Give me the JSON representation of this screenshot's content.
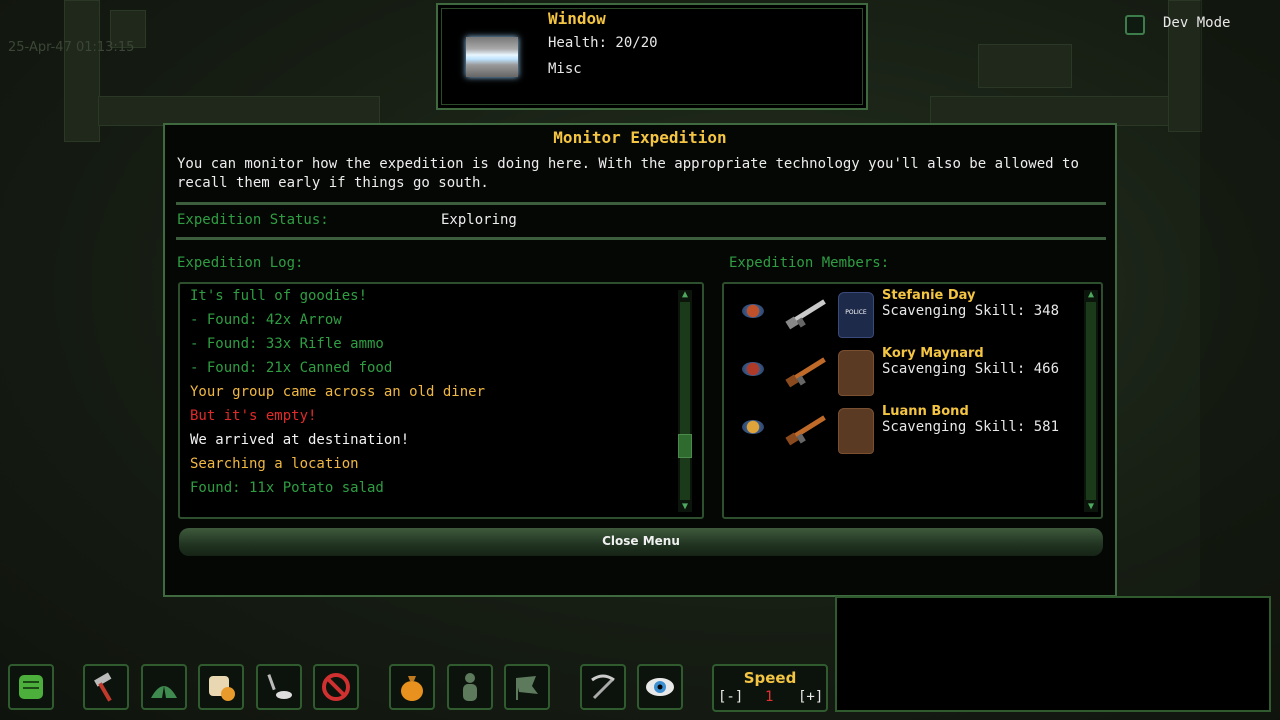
{
  "date_stamp": "25-Apr-47 01:13:15",
  "info_window": {
    "title": "Window",
    "health": "Health: 20/20",
    "category": "Misc"
  },
  "dev_mode": {
    "label": "Dev Mode",
    "checked": false
  },
  "dialog": {
    "title": "Monitor Expedition",
    "description": "You can monitor how the expedition is doing here. With the appropriate technology you'll also be allowed to recall them early if things go south.",
    "status_label": "Expedition Status:",
    "status_value": "Exploring",
    "log_label": "Expedition Log:",
    "members_label": "Expedition Members:",
    "log": [
      {
        "text": "It's full of goodies!",
        "color": "#2f9e43"
      },
      {
        "text": "- Found: 42x Arrow",
        "color": "#2f9e43"
      },
      {
        "text": "- Found: 33x Rifle ammo",
        "color": "#2f9e43"
      },
      {
        "text": "- Found: 21x Canned food",
        "color": "#2f9e43"
      },
      {
        "text": "Your group came across an old diner",
        "color": "#f0b842"
      },
      {
        "text": "But it's empty!",
        "color": "#e02a2a"
      },
      {
        "text": "We arrived at destination!",
        "color": "#f2f2f2"
      },
      {
        "text": "Searching a location",
        "color": "#f0b842"
      },
      {
        "text": "Found: 11x Potato salad",
        "color": "#2f9e43"
      }
    ],
    "members": [
      {
        "name": "Stefanie Day",
        "skill": "Scavenging Skill: 348",
        "badge_color": "#c0502a",
        "vest": "police-vest",
        "vest_text": "POLICE",
        "weapon": "assault-rifle"
      },
      {
        "name": "Kory Maynard",
        "skill": "Scavenging Skill: 466",
        "badge_color": "#b03a28",
        "vest": "leather-vest",
        "vest_text": "",
        "weapon": "shotgun"
      },
      {
        "name": "Luann Bond",
        "skill": "Scavenging Skill: 581",
        "badge_color": "#e0a53a",
        "vest": "leather-vest",
        "vest_text": "",
        "weapon": "ak-rifle"
      }
    ],
    "close_label": "Close Menu"
  },
  "toolbar": {
    "speed_label": "Speed",
    "speed_minus": "[-]",
    "speed_value": "1",
    "speed_plus": "[+]"
  }
}
